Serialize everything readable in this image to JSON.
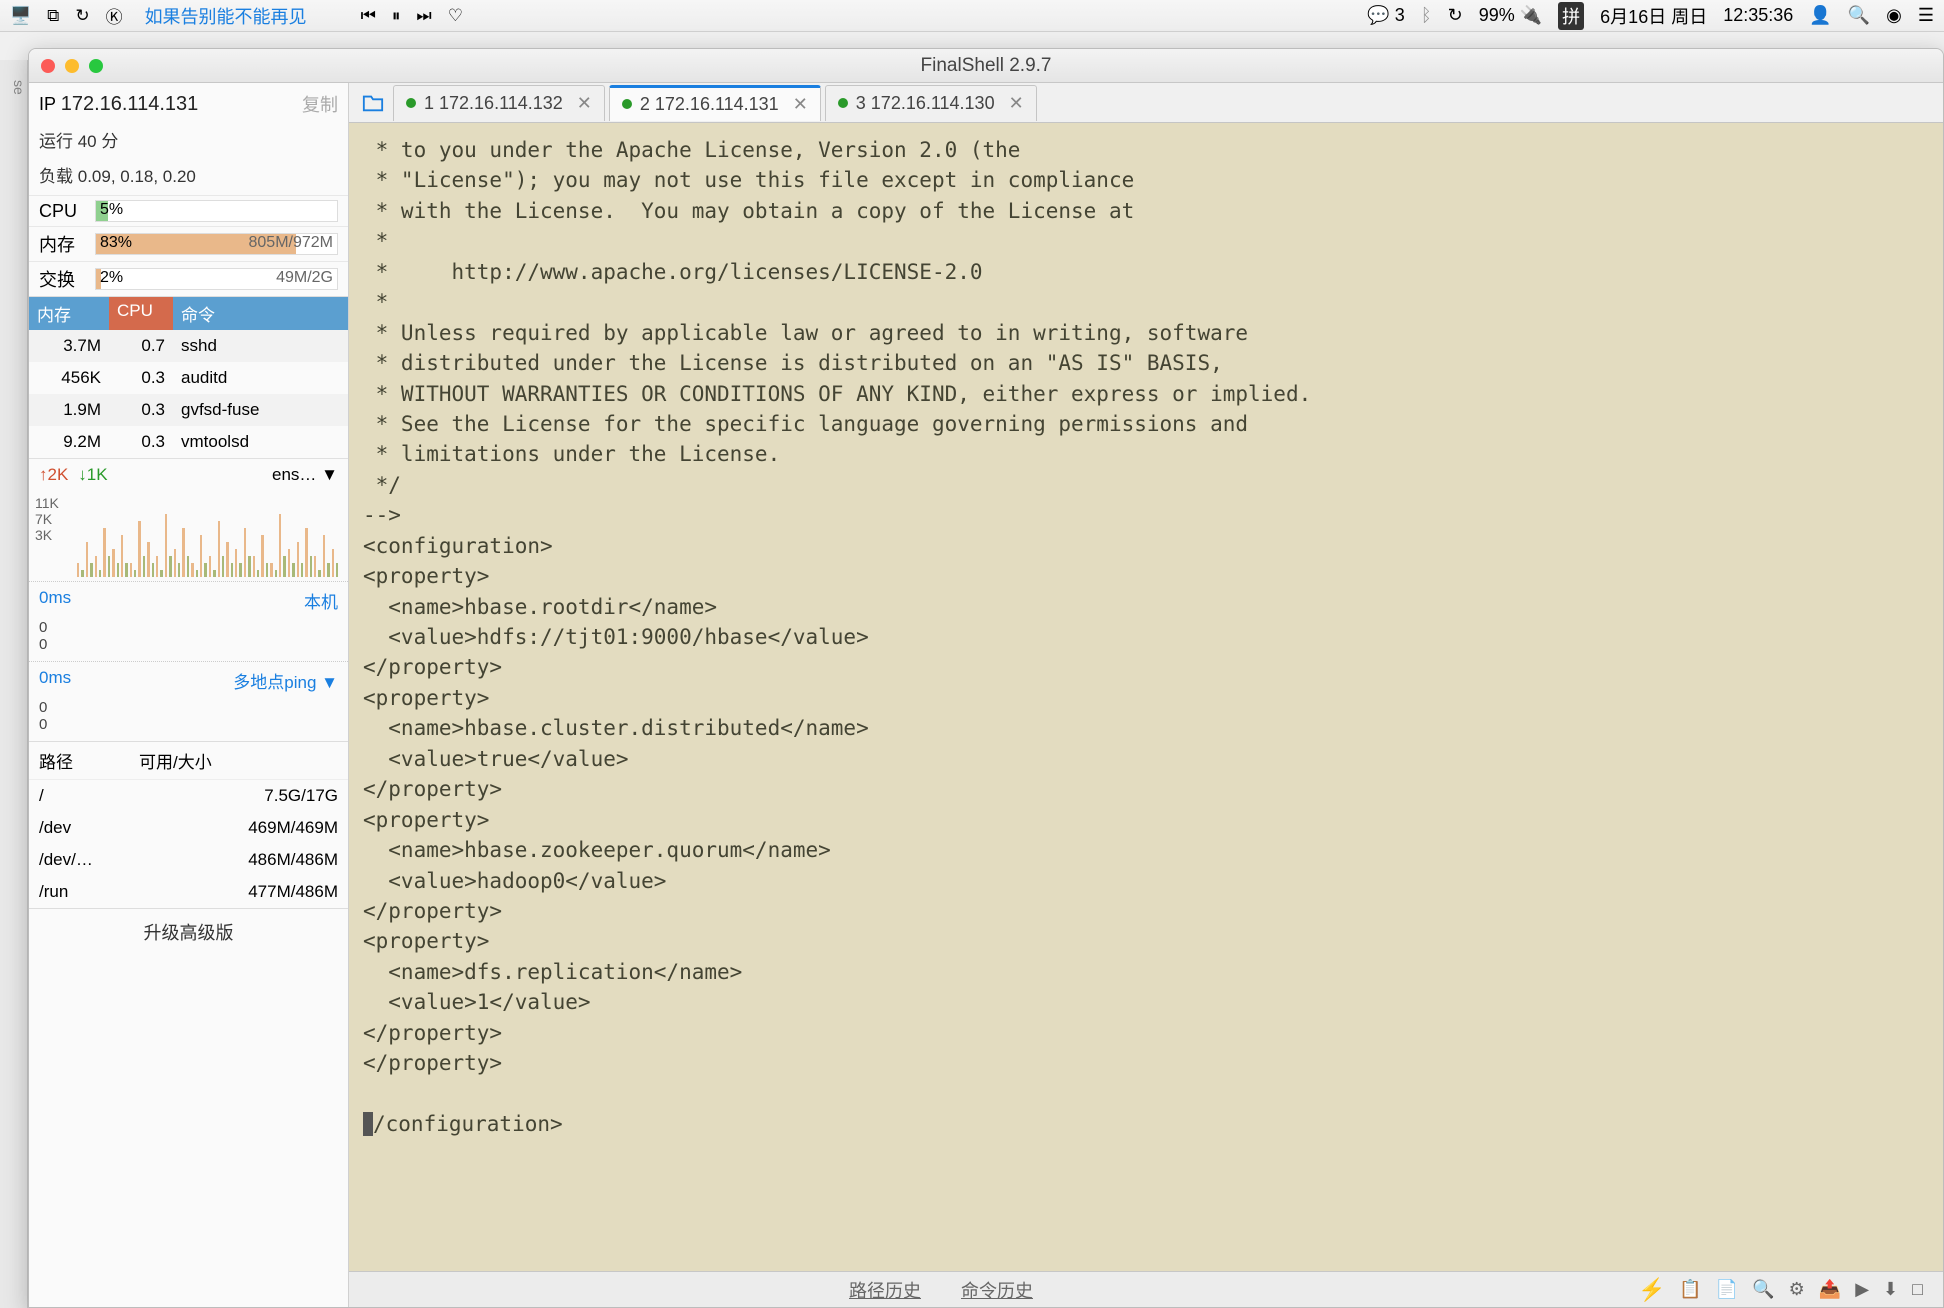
{
  "menubar": {
    "song": "如果告别能不能再见",
    "battery": "99%",
    "ime": "拼",
    "date": "6月16日 周日",
    "time": "12:35:36",
    "wechat_count": "3"
  },
  "window": {
    "title": "FinalShell 2.9.7"
  },
  "sidebar": {
    "ip_label": "IP",
    "ip": "172.16.114.131",
    "copy": "复制",
    "uptime": "运行 40 分",
    "load_label": "负载",
    "load": "0.09, 0.18, 0.20",
    "stats": {
      "cpu_label": "CPU",
      "cpu_pct": "5%",
      "cpu_width": 5,
      "mem_label": "内存",
      "mem_pct": "83%",
      "mem_right": "805M/972M",
      "mem_width": 83,
      "swap_label": "交换",
      "swap_pct": "2%",
      "swap_right": "49M/2G",
      "swap_width": 2
    },
    "proc_headers": {
      "mem": "内存",
      "cpu": "CPU",
      "cmd": "命令"
    },
    "procs": [
      {
        "mem": "3.7M",
        "cpu": "0.7",
        "cmd": "sshd"
      },
      {
        "mem": "456K",
        "cpu": "0.3",
        "cmd": "auditd"
      },
      {
        "mem": "1.9M",
        "cpu": "0.3",
        "cmd": "gvfsd-fuse"
      },
      {
        "mem": "9.2M",
        "cpu": "0.3",
        "cmd": "vmtoolsd"
      }
    ],
    "net": {
      "up": "2K",
      "down": "1K",
      "iface": "ens…",
      "y1": "11K",
      "y2": "7K",
      "y3": "3K"
    },
    "latency1": {
      "time": "0ms",
      "label": "本机",
      "vals": [
        "0",
        "0"
      ]
    },
    "latency2": {
      "time": "0ms",
      "label": "多地点ping ▼",
      "vals": [
        "0",
        "0"
      ]
    },
    "disk_headers": {
      "path": "路径",
      "avail": "可用/大小"
    },
    "disks": [
      {
        "path": "/",
        "size": "7.5G/17G"
      },
      {
        "path": "/dev",
        "size": "469M/469M"
      },
      {
        "path": "/dev/…",
        "size": "486M/486M"
      },
      {
        "path": "/run",
        "size": "477M/486M"
      }
    ],
    "upgrade": "升级高级版"
  },
  "tabs": [
    {
      "num": "1",
      "host": "172.16.114.132",
      "active": false
    },
    {
      "num": "2",
      "host": "172.16.114.131",
      "active": true
    },
    {
      "num": "3",
      "host": "172.16.114.130",
      "active": false
    }
  ],
  "terminal": " * to you under the Apache License, Version 2.0 (the\n * \"License\"); you may not use this file except in compliance\n * with the License.  You may obtain a copy of the License at\n *\n *     http://www.apache.org/licenses/LICENSE-2.0\n *\n * Unless required by applicable law or agreed to in writing, software\n * distributed under the License is distributed on an \"AS IS\" BASIS,\n * WITHOUT WARRANTIES OR CONDITIONS OF ANY KIND, either express or implied.\n * See the License for the specific language governing permissions and\n * limitations under the License.\n */\n-->\n<configuration>\n<property>\n  <name>hbase.rootdir</name>\n  <value>hdfs://tjt01:9000/hbase</value>\n</property>\n<property>\n  <name>hbase.cluster.distributed</name>\n  <value>true</value>\n</property>\n<property>\n  <name>hbase.zookeeper.quorum</name>\n  <value>hadoop0</value>\n</property>\n<property>\n  <name>dfs.replication</name>\n  <value>1</value>\n</property>\n</property>\n\n",
  "terminal_end": "/configuration>",
  "statusbar": {
    "path_history": "路径历史",
    "cmd_history": "命令历史"
  },
  "leftedge": "se",
  "chart_data": {
    "type": "bar",
    "title": "Network traffic",
    "ylabel": "",
    "ylim": [
      0,
      11
    ],
    "y_ticks": [
      "11K",
      "7K",
      "3K"
    ],
    "series": [
      {
        "name": "up",
        "values": [
          2,
          5,
          3,
          7,
          4,
          6,
          2,
          8,
          5,
          3,
          9,
          4,
          7,
          2,
          6,
          3,
          8,
          5,
          4,
          7,
          3,
          6,
          2,
          9,
          4,
          5,
          7,
          3,
          6,
          4
        ]
      },
      {
        "name": "down",
        "values": [
          1,
          2,
          1,
          3,
          2,
          2,
          1,
          3,
          2,
          1,
          3,
          2,
          3,
          1,
          2,
          1,
          3,
          2,
          2,
          3,
          1,
          2,
          1,
          3,
          2,
          2,
          3,
          1,
          2,
          2
        ]
      }
    ]
  }
}
